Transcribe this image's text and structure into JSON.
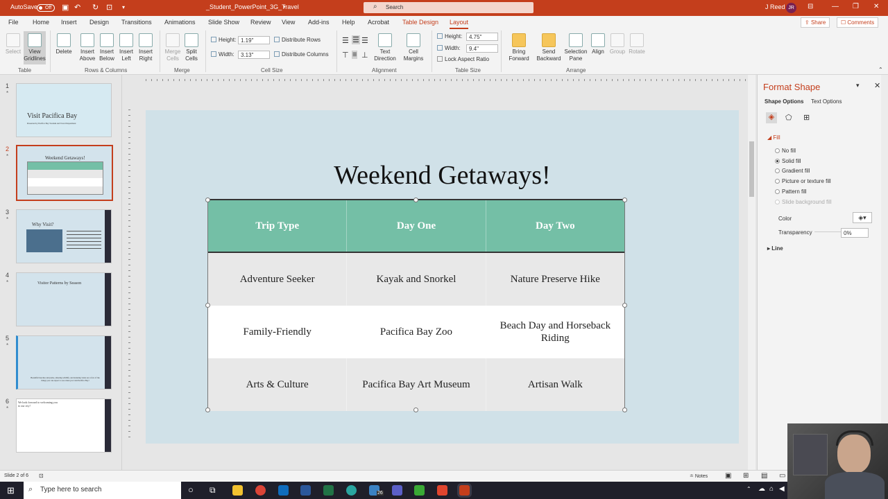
{
  "titlebar": {
    "autosave_label": "AutoSave",
    "autosave_state": "Off",
    "filename": "_Student_PowerPoint_3G_Travel",
    "search_placeholder": "Search",
    "user_name": "J Reed",
    "user_initials": "JR",
    "accent": "#c43e1c"
  },
  "tabs": [
    "File",
    "Home",
    "Insert",
    "Design",
    "Transitions",
    "Animations",
    "Slide Show",
    "Review",
    "View",
    "Add-ins",
    "Help",
    "Acrobat",
    "Table Design",
    "Layout"
  ],
  "active_tab": "Layout",
  "share_label": "Share",
  "comments_label": "Comments",
  "ribbon": {
    "select": "Select",
    "view_gridlines": "View Gridlines",
    "delete": "Delete",
    "insert_above": "Insert Above",
    "insert_below": "Insert Below",
    "insert_left": "Insert Left",
    "insert_right": "Insert Right",
    "merge_cells": "Merge Cells",
    "split_cells": "Split Cells",
    "height_label": "Height:",
    "height_value": "1.19\"",
    "width_label": "Width:",
    "width_value": "3.13\"",
    "distribute_rows": "Distribute Rows",
    "distribute_columns": "Distribute Columns",
    "text_direction": "Text Direction",
    "cell_margins": "Cell Margins",
    "table_height_label": "Height:",
    "table_height_value": "4.75\"",
    "table_width_label": "Width:",
    "table_width_value": "9.4\"",
    "lock_aspect": "Lock Aspect Ratio",
    "bring_forward": "Bring Forward",
    "send_backward": "Send Backward",
    "selection_pane": "Selection Pane",
    "align": "Align",
    "group": "Group",
    "rotate": "Rotate",
    "groups": [
      "Table",
      "Rows & Columns",
      "Merge",
      "Cell Size",
      "Alignment",
      "Table Size",
      "Arrange"
    ]
  },
  "slides": [
    {
      "num": "1",
      "title": "Visit Pacifica Bay",
      "sub": "Presented by Pacifica Bay Tourism and Travel Department"
    },
    {
      "num": "2",
      "title": "Weekend Getaways!"
    },
    {
      "num": "3",
      "title": "Why Visit?"
    },
    {
      "num": "4",
      "title": "Visitor Patterns by Season"
    },
    {
      "num": "5",
      "title": "Beautiful beaches and parks, amazing wildlife, and stunning vistas are a few of the things you can expect to see when you visit Pacifica Bay!"
    },
    {
      "num": "6",
      "title": "We look forward to welcoming you to our city!"
    }
  ],
  "slide": {
    "title": "Weekend Getaways!",
    "table": {
      "headers": [
        "Trip Type",
        "Day One",
        "Day Two"
      ],
      "rows": [
        [
          "Adventure Seeker",
          "Kayak and Snorkel",
          "Nature Preserve Hike"
        ],
        [
          "Family-Friendly",
          "Pacifica Bay Zoo",
          "Beach Day and Horseback Riding"
        ],
        [
          "Arts & Culture",
          "Pacifica Bay Art Museum",
          "Artisan Walk"
        ]
      ],
      "header_color": "#74bfa6"
    }
  },
  "format_pane": {
    "title": "Format Shape",
    "tab_shape": "Shape Options",
    "tab_text": "Text Options",
    "fill_section": "Fill",
    "fill_options": [
      "No fill",
      "Solid fill",
      "Gradient fill",
      "Picture or texture fill",
      "Pattern fill",
      "Slide background fill"
    ],
    "selected_fill": "Solid fill",
    "color_label": "Color",
    "transparency_label": "Transparency",
    "transparency_value": "0%",
    "line_section": "Line"
  },
  "status": {
    "slide_info": "Slide 2 of 6",
    "notes": "Notes"
  },
  "taskbar": {
    "search_placeholder": "Type here to search",
    "badge": "26"
  }
}
